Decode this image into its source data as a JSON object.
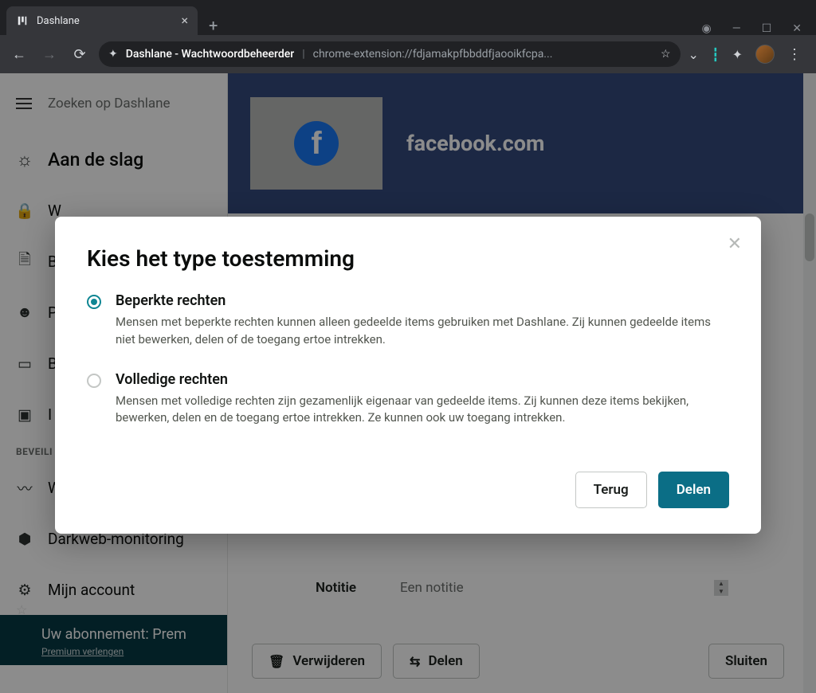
{
  "browser": {
    "tab_title": "Dashlane",
    "url_title": "Dashlane - Wachtwoordbeheerder",
    "url_path": "chrome-extension://fdjamakpfbbddfjaooikfcpa..."
  },
  "sidebar": {
    "search_placeholder": "Zoeken op Dashlane",
    "items": [
      {
        "label": "Aan de slag"
      },
      {
        "label": "W"
      },
      {
        "label": "B"
      },
      {
        "label": "P"
      },
      {
        "label": "B"
      },
      {
        "label": "I"
      }
    ],
    "category": "BEVEILI",
    "sec_items": [
      {
        "label": "W"
      },
      {
        "label": "Darkweb-monitoring"
      },
      {
        "label": "Mijn account"
      }
    ],
    "subscription_line1": "Uw abonnement: Prem",
    "subscription_line2": "Premium verlengen"
  },
  "main": {
    "hero_title": "facebook.com",
    "note_label": "Notitie",
    "note_placeholder": "Een notitie",
    "delete_label": "Verwijderen",
    "share_label": "Delen",
    "close_label": "Sluiten"
  },
  "modal": {
    "title": "Kies het type toestemming",
    "options": [
      {
        "title": "Beperkte rechten",
        "desc": "Mensen met beperkte rechten kunnen alleen gedeelde items gebruiken met Dashlane. Zij kunnen gedeelde items niet bewerken, delen of de toegang ertoe intrekken.",
        "selected": true
      },
      {
        "title": "Volledige rechten",
        "desc": "Mensen met volledige rechten zijn gezamenlijk eigenaar van gedeelde items. Zij kunnen deze items bekijken, bewerken, delen en de toegang ertoe intrekken. Ze kunnen ook uw toegang intrekken.",
        "selected": false
      }
    ],
    "back_label": "Terug",
    "share_label": "Delen"
  }
}
